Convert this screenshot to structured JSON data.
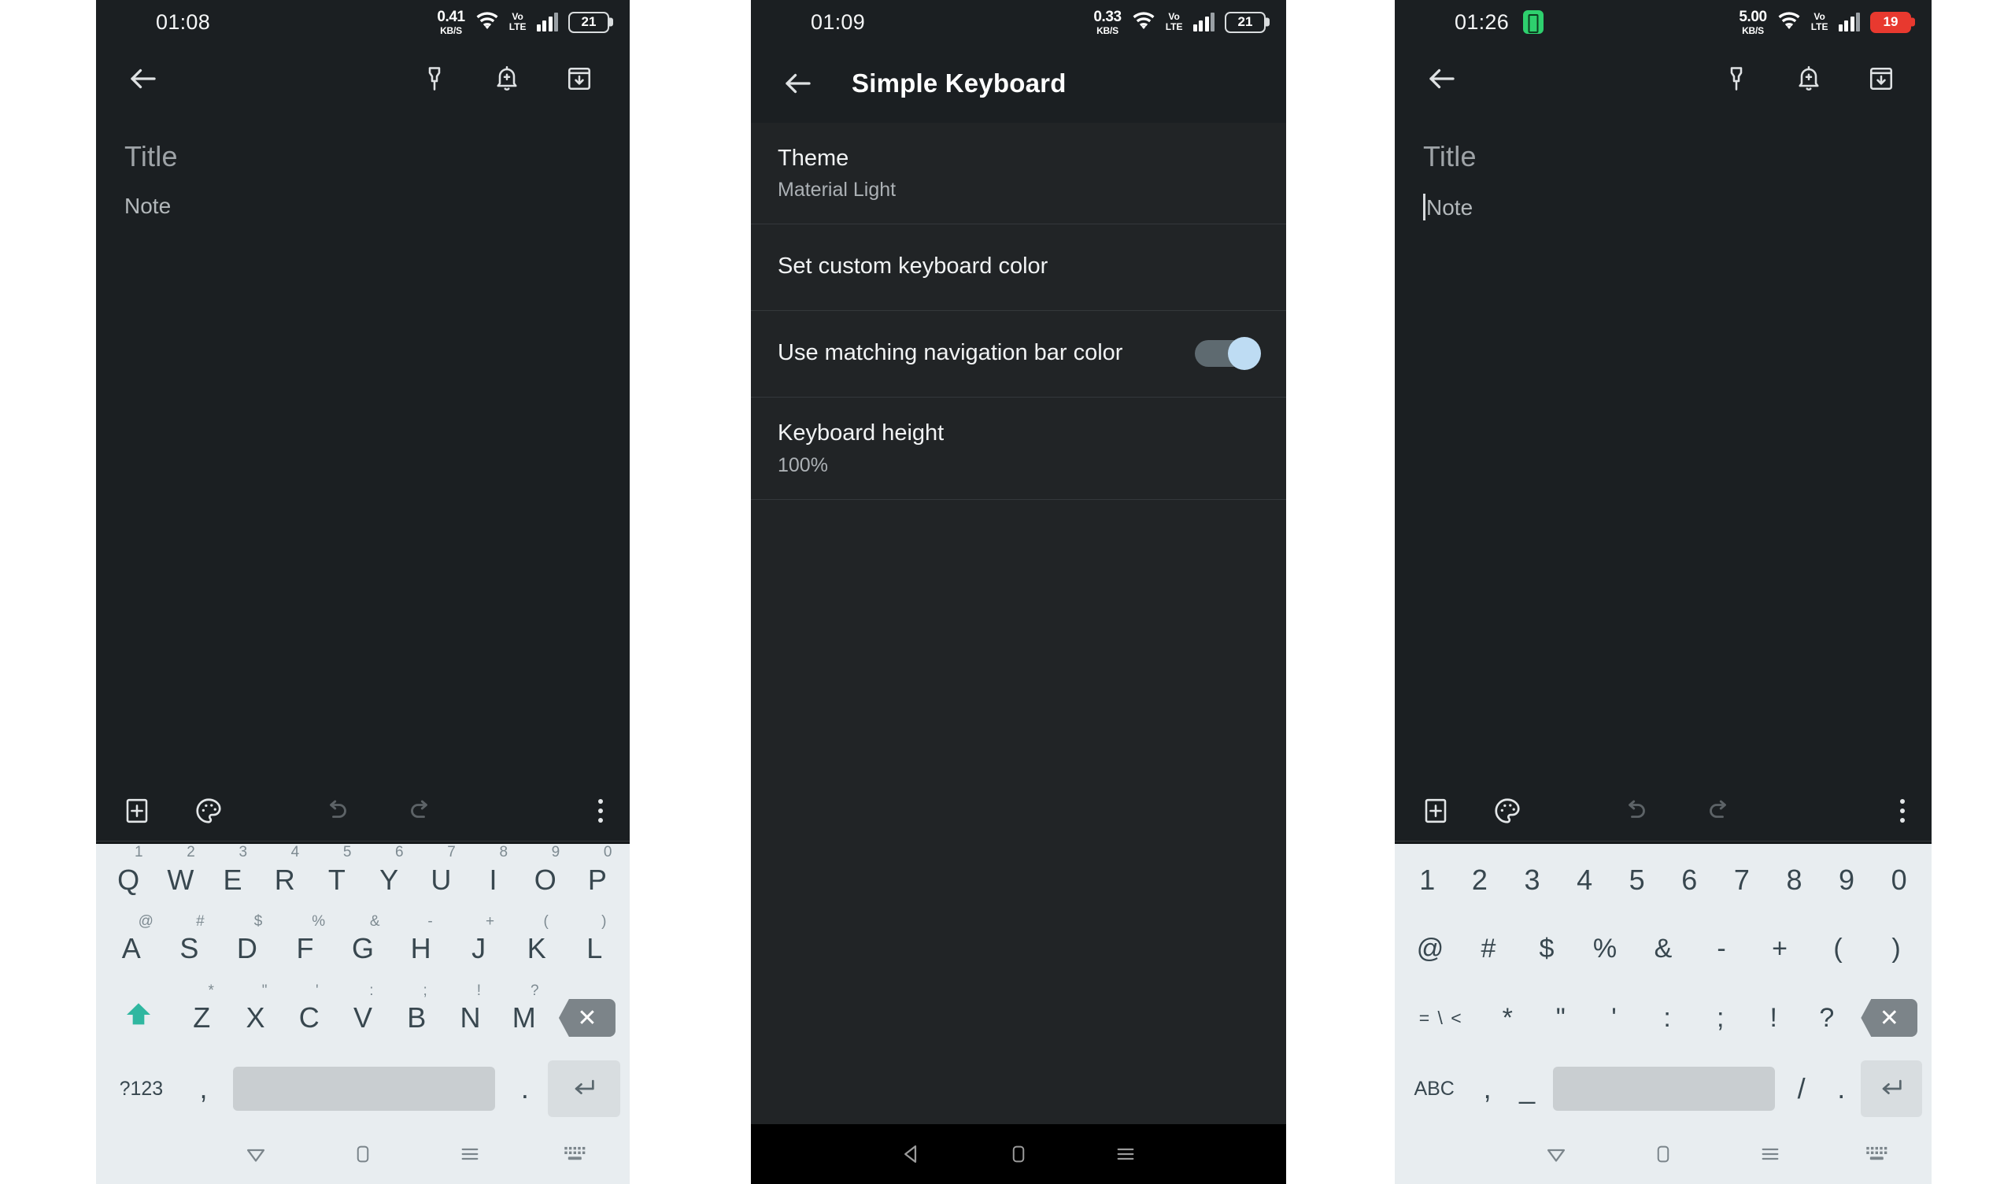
{
  "panels": [
    {
      "id": "note-editor-before",
      "statusbar": {
        "clock": "01:08",
        "net_speed_value": "0.41",
        "net_speed_unit": "KB/S",
        "volte_top": "Vo",
        "volte_bottom": "LTE",
        "battery": "21",
        "battery_low": false,
        "saver_icon": false
      },
      "toolbar": {
        "back": "back-arrow",
        "pin": "pin",
        "reminder": "bell-plus",
        "archive": "archive-down"
      },
      "note": {
        "title_placeholder": "Title",
        "body_placeholder": "Note",
        "caret": false
      },
      "bottombar": {
        "new_note": "new-note",
        "palette": "palette",
        "undo": "undo",
        "redo": "redo",
        "more": "more-vert"
      },
      "keyboard": {
        "mode": "letters",
        "row1": [
          {
            "main": "Q",
            "sup": "1"
          },
          {
            "main": "W",
            "sup": "2"
          },
          {
            "main": "E",
            "sup": "3"
          },
          {
            "main": "R",
            "sup": "4"
          },
          {
            "main": "T",
            "sup": "5"
          },
          {
            "main": "Y",
            "sup": "6"
          },
          {
            "main": "U",
            "sup": "7"
          },
          {
            "main": "I",
            "sup": "8"
          },
          {
            "main": "O",
            "sup": "9"
          },
          {
            "main": "P",
            "sup": "0"
          }
        ],
        "row2": [
          {
            "main": "A",
            "sup": "@"
          },
          {
            "main": "S",
            "sup": "#"
          },
          {
            "main": "D",
            "sup": "$"
          },
          {
            "main": "F",
            "sup": "%"
          },
          {
            "main": "G",
            "sup": "&"
          },
          {
            "main": "H",
            "sup": "-"
          },
          {
            "main": "J",
            "sup": "+"
          },
          {
            "main": "K",
            "sup": "("
          },
          {
            "main": "L",
            "sup": ")"
          }
        ],
        "row3_shift": "shift-arrow",
        "row3": [
          {
            "main": "Z",
            "sup": "*"
          },
          {
            "main": "X",
            "sup": "\""
          },
          {
            "main": "C",
            "sup": "'"
          },
          {
            "main": "V",
            "sup": ":"
          },
          {
            "main": "B",
            "sup": ";"
          },
          {
            "main": "N",
            "sup": "!"
          },
          {
            "main": "M",
            "sup": "?"
          }
        ],
        "row3_backspace": "backspace",
        "row4": {
          "switch": "?123",
          "comma": ",",
          "space": "",
          "period": ".",
          "enter": "enter-arrow"
        }
      },
      "navbar": {
        "style": "light",
        "buttons": [
          "back-triangle",
          "home-square",
          "recents-menu",
          "keyboard-switch"
        ]
      }
    },
    {
      "id": "simple-keyboard-settings",
      "statusbar": {
        "clock": "01:09",
        "net_speed_value": "0.33",
        "net_speed_unit": "KB/S",
        "volte_top": "Vo",
        "volte_bottom": "LTE",
        "battery": "21",
        "battery_low": false,
        "saver_icon": false
      },
      "header": {
        "back": "back-arrow",
        "title": "Simple Keyboard"
      },
      "settings": [
        {
          "label": "Theme",
          "sub": "Material Light",
          "toggle": null
        },
        {
          "label": "Set custom keyboard color",
          "sub": null,
          "toggle": null
        },
        {
          "label": "Use matching navigation bar color",
          "sub": null,
          "toggle": true
        },
        {
          "label": "Keyboard height",
          "sub": "100%",
          "toggle": null
        }
      ],
      "navbar": {
        "style": "dark",
        "buttons": [
          "back-triangle",
          "home-square",
          "recents-menu"
        ]
      }
    },
    {
      "id": "note-editor-after",
      "statusbar": {
        "clock": "01:26",
        "net_speed_value": "5.00",
        "net_speed_unit": "KB/S",
        "volte_top": "Vo",
        "volte_bottom": "LTE",
        "battery": "19",
        "battery_low": true,
        "saver_icon": true
      },
      "toolbar": {
        "back": "back-arrow",
        "pin": "pin",
        "reminder": "bell-plus",
        "archive": "archive-down"
      },
      "note": {
        "title_placeholder": "Title",
        "body_placeholder": "Note",
        "caret": true
      },
      "bottombar": {
        "new_note": "new-note",
        "palette": "palette",
        "undo": "undo",
        "redo": "redo",
        "more": "more-vert"
      },
      "keyboard": {
        "mode": "symbols",
        "row1": [
          {
            "main": "1"
          },
          {
            "main": "2"
          },
          {
            "main": "3"
          },
          {
            "main": "4"
          },
          {
            "main": "5"
          },
          {
            "main": "6"
          },
          {
            "main": "7"
          },
          {
            "main": "8"
          },
          {
            "main": "9"
          },
          {
            "main": "0"
          }
        ],
        "row2": [
          {
            "main": "@"
          },
          {
            "main": "#"
          },
          {
            "main": "$"
          },
          {
            "main": "%"
          },
          {
            "main": "&"
          },
          {
            "main": "-"
          },
          {
            "main": "+"
          },
          {
            "main": "("
          },
          {
            "main": ")"
          }
        ],
        "row3_switch": "= \\ <",
        "row3": [
          {
            "main": "*"
          },
          {
            "main": "\""
          },
          {
            "main": "'"
          },
          {
            "main": ":"
          },
          {
            "main": ";"
          },
          {
            "main": "!"
          },
          {
            "main": "?"
          }
        ],
        "row3_backspace": "backspace",
        "row4": {
          "switch": "ABC",
          "comma": ",",
          "underscore": "_",
          "space": "",
          "slash": "/",
          "period": ".",
          "enter": "enter-arrow"
        }
      },
      "navbar": {
        "style": "light",
        "buttons": [
          "back-triangle",
          "home-square",
          "recents-menu",
          "keyboard-switch"
        ]
      }
    }
  ],
  "colors": {
    "app_background": "#1b1f22",
    "settings_row": "#212426",
    "keyboard_background": "#e8edf0",
    "key_text": "#38474f",
    "shift_accent": "#2fb7a0",
    "toggle_on": "#bedcf3",
    "battery_low": "#e8392f",
    "battery_saver": "#2ed06e"
  }
}
